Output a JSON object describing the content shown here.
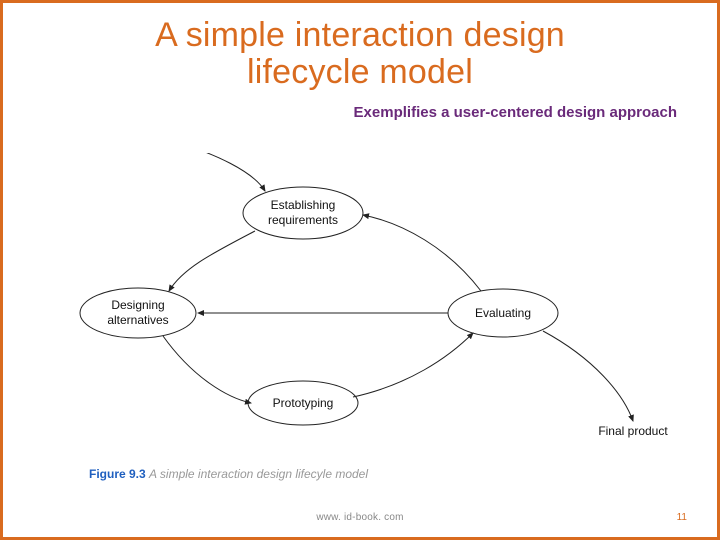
{
  "slide": {
    "title_line1": "A simple interaction design",
    "title_line2": "lifecycle model",
    "subtitle": "Exemplifies a user-centered design approach",
    "footer_url": "www. id-book. com",
    "number": "11"
  },
  "diagram": {
    "nodes": {
      "establishing_l1": "Establishing",
      "establishing_l2": "requirements",
      "designing_l1": "Designing",
      "designing_l2": "alternatives",
      "prototyping": "Prototyping",
      "evaluating": "Evaluating",
      "final_product": "Final product"
    },
    "caption_fig": "Figure 9.3",
    "caption_text": "A simple interaction design lifecyle model"
  }
}
